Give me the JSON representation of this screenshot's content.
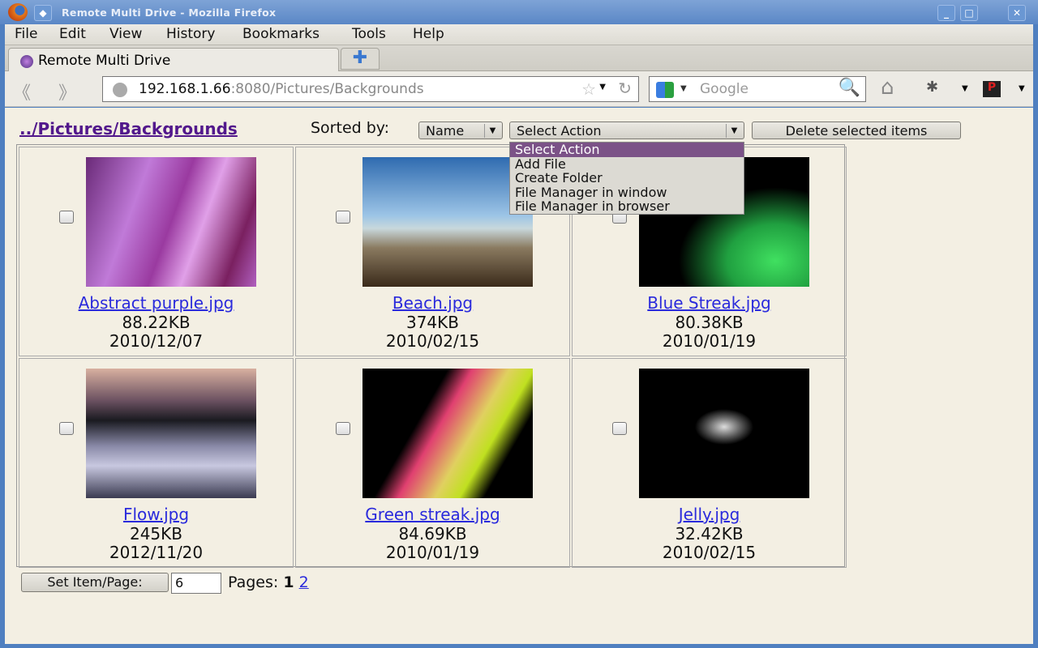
{
  "window": {
    "title": "Remote Multi Drive - Mozilla Firefox",
    "min": "_",
    "max": "□",
    "close": "✕"
  },
  "menu": [
    "File",
    "Edit",
    "View",
    "History",
    "Bookmarks",
    "Tools",
    "Help"
  ],
  "tab": {
    "label": "Remote Multi Drive",
    "new_tab": "✚"
  },
  "nav": {
    "url_host": "192.168.1.66",
    "url_rest": ":8080/Pictures/Backgrounds",
    "search_placeholder": "Google"
  },
  "page": {
    "breadcrumb": "../Pictures/Backgrounds",
    "sorted_by_label": "Sorted by:",
    "sort_value": "Name",
    "action_value": "Select Action",
    "action_options": [
      "Select Action",
      "Add File",
      "Create Folder",
      "File Manager in window",
      "File Manager in browser"
    ],
    "delete_button": "Delete selected items",
    "items": [
      {
        "name": "Abstract purple.jpg",
        "size": "88.22KB",
        "date": "2010/12/07"
      },
      {
        "name": "Beach.jpg",
        "size": "374KB",
        "date": "2010/02/15"
      },
      {
        "name": "Blue Streak.jpg",
        "size": "80.38KB",
        "date": "2010/01/19"
      },
      {
        "name": "Flow.jpg",
        "size": "245KB",
        "date": "2012/11/20"
      },
      {
        "name": "Green streak.jpg",
        "size": "84.69KB",
        "date": "2010/01/19"
      },
      {
        "name": "Jelly.jpg",
        "size": "32.42KB",
        "date": "2010/02/15"
      }
    ],
    "set_items_button": "Set Item/Page:",
    "items_per_page": "6",
    "pages_label": "Pages:",
    "current_page": "1",
    "other_page": "2"
  }
}
